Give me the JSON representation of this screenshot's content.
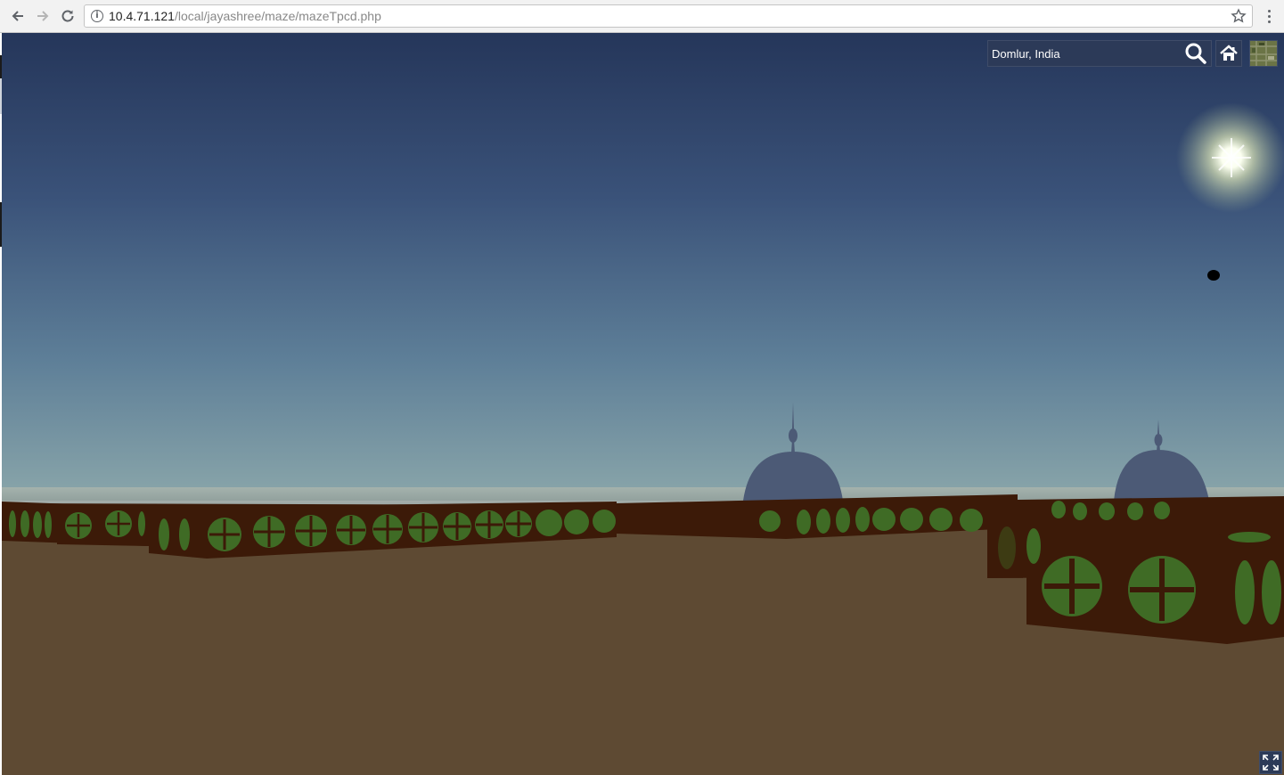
{
  "browser": {
    "url_host": "10.4.71.121",
    "url_path": "/local/jayashree/maze/mazeTpcd.php",
    "icons": {
      "back": "arrow-left-icon",
      "forward": "arrow-right-icon",
      "reload": "reload-icon",
      "info": "info-icon",
      "bookmark": "star-icon",
      "menu": "kebab-menu-icon"
    }
  },
  "viewer": {
    "search": {
      "value": "Domlur, India",
      "icon": "search-icon"
    },
    "home_icon": "home-icon",
    "layer_picker_icon": "imagery-thumbnail-icon",
    "fullscreen_icon": "fullscreen-icon"
  },
  "scene": {
    "sky_top_color": "#25365a",
    "sky_horizon_color": "#7e9bab",
    "ground_color": "#5e4a33",
    "wall_color": "#3c1a08",
    "wall_pattern_color": "#3f6b25",
    "dome_color": "#4c5a76"
  }
}
